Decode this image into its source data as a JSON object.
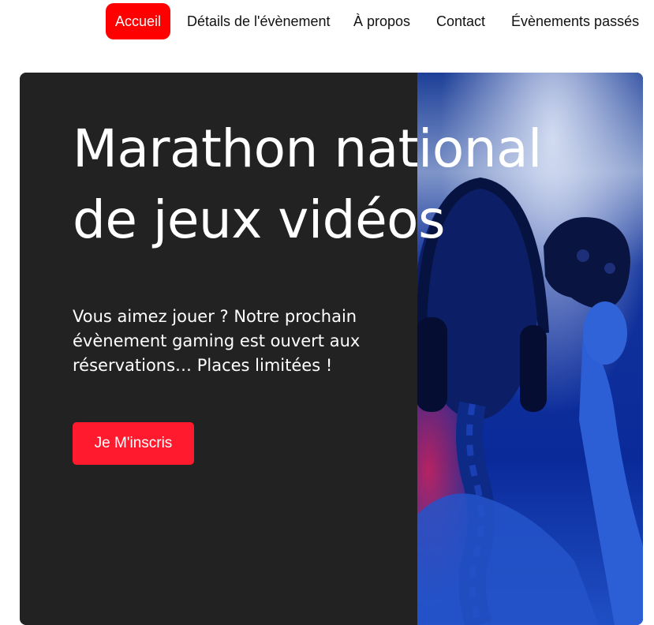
{
  "nav": {
    "items": [
      {
        "label": "Accueil",
        "active": true
      },
      {
        "label": "Détails de l'évènement",
        "active": false
      },
      {
        "label": "À propos",
        "active": false
      },
      {
        "label": "Contact",
        "active": false
      },
      {
        "label": "Évènements passés",
        "active": false
      }
    ]
  },
  "hero": {
    "title_line1": "Marathon national",
    "title_line2": "de jeux vidéos",
    "description_line1": "Vous aimez jouer ? Notre prochain",
    "description_line2": "évènement gaming est ouvert aux",
    "description_line3": "réservations… Places limitées !",
    "cta_label": "Je M'inscris",
    "image_alt": "Joueuse de dos avec un casque et une manette, éclairage bleu"
  },
  "colors": {
    "accent": "#ff0000",
    "cta": "#ff1a2e",
    "hero_background": "#222222",
    "image_tint": "#1a4fd0"
  }
}
